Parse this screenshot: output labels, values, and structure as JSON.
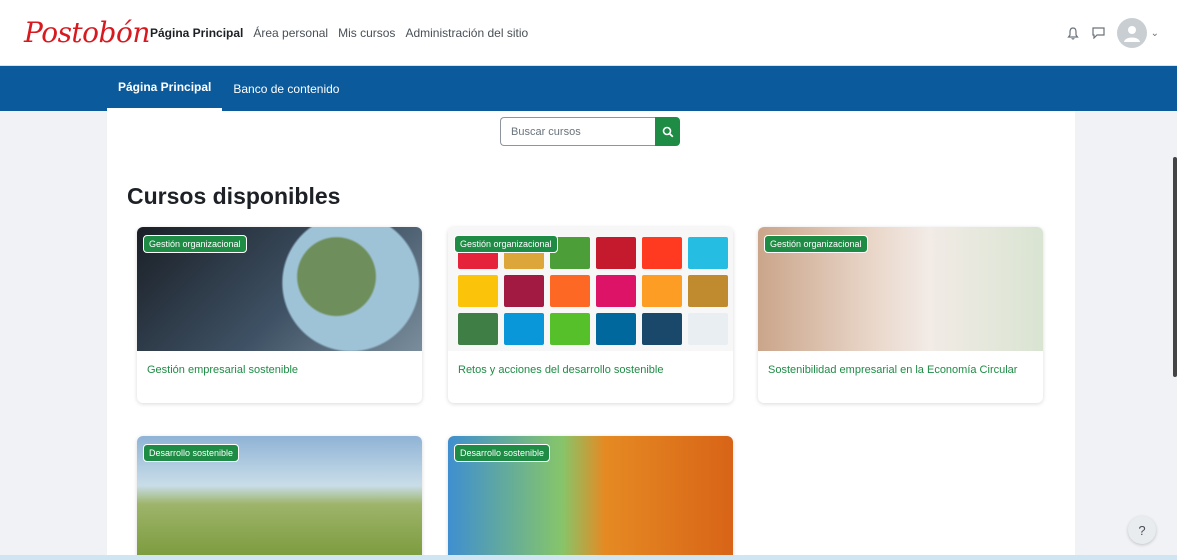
{
  "brand": {
    "logo_text": "Postobón"
  },
  "primary_nav": [
    {
      "label": "Página Principal",
      "active": true
    },
    {
      "label": "Área personal",
      "active": false
    },
    {
      "label": "Mis cursos",
      "active": false
    },
    {
      "label": "Administración del sitio",
      "active": false
    }
  ],
  "secondary_nav": [
    {
      "label": "Página Principal",
      "active": true
    },
    {
      "label": "Banco de contenido",
      "active": false
    }
  ],
  "search": {
    "placeholder": "Buscar cursos"
  },
  "heading": "Cursos disponibles",
  "courses": [
    {
      "category": "Gestión organizacional",
      "title": "Gestión empresarial sostenible"
    },
    {
      "category": "Gestión organizacional",
      "title": "Retos y acciones del desarrollo sostenible"
    },
    {
      "category": "Gestión organizacional",
      "title": "Sostenibilidad empresarial en la Economía Circular"
    },
    {
      "category": "Desarrollo sostenible",
      "title": ""
    },
    {
      "category": "Desarrollo sostenible",
      "title": ""
    }
  ],
  "help": {
    "label": "?"
  },
  "colors": {
    "brand_red": "#d71920",
    "nav_blue": "#0a5a9c",
    "accent_green": "#1e8c45"
  }
}
